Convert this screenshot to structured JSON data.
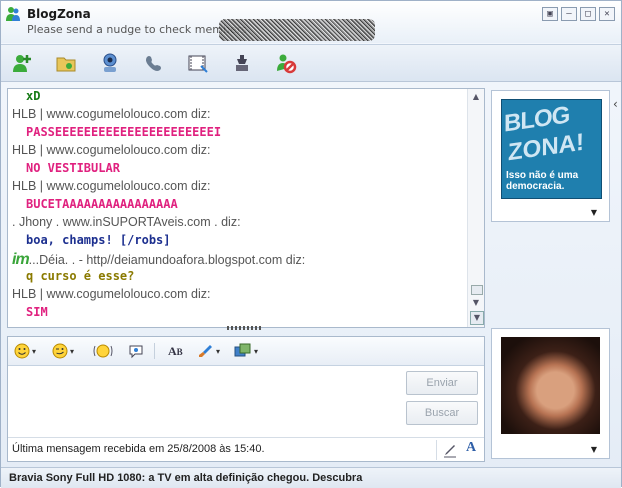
{
  "window": {
    "title": "BlogZona",
    "subtitle": "Please send a nudge to check members",
    "controls": [
      "▣",
      "—",
      "□",
      "✕"
    ]
  },
  "toolbar": {
    "icons": [
      "invite-contact-icon",
      "share-files-icon",
      "video-call-icon",
      "call-icon",
      "activities-icon",
      "games-icon",
      "block-icon"
    ]
  },
  "conversation": {
    "messages": [
      {
        "kind": "text",
        "text": "xD",
        "color": "#157a15"
      },
      {
        "kind": "who",
        "text": "HLB | www.cogumelolouco.com diz:"
      },
      {
        "kind": "text",
        "text": "PASSEEEEEEEEEEEEEEEEEEEEEEI",
        "color": "#e0217f"
      },
      {
        "kind": "who",
        "text": "HLB | www.cogumelolouco.com diz:"
      },
      {
        "kind": "text",
        "text": "NO VESTIBULAR",
        "color": "#e0217f"
      },
      {
        "kind": "who",
        "text": "HLB | www.cogumelolouco.com diz:"
      },
      {
        "kind": "text",
        "text": "BUCETAAAAAAAAAAAAAAAA",
        "color": "#e0217f"
      },
      {
        "kind": "who",
        "text": ".   Jhony   .  www.inSUPORTAveis.com  . diz:"
      },
      {
        "kind": "text",
        "text": "boa, champs! [/robs]",
        "color": "#1c2f8f"
      },
      {
        "kind": "who",
        "text": "...Déia. .   - http//deiamundoafora.blogspot.com diz:",
        "badge": "im"
      },
      {
        "kind": "text",
        "text": "q curso é esse?",
        "color": "#8a7a00"
      },
      {
        "kind": "who",
        "text": "HLB | www.cogumelolouco.com diz:"
      },
      {
        "kind": "text",
        "text": "SIM",
        "color": "#e0217f"
      }
    ]
  },
  "input": {
    "send_label": "Enviar",
    "search_label": "Buscar",
    "status_text": "Última mensagem recebida em 25/8/2008 às 15:40."
  },
  "display_picture_logo": {
    "line1": "BLOG",
    "line2": "ZONA!",
    "line3": "Isso não é uma democracia."
  },
  "ad": {
    "text": "Bravia Sony Full HD 1080: a TV em alta definição chegou. Descubra"
  }
}
